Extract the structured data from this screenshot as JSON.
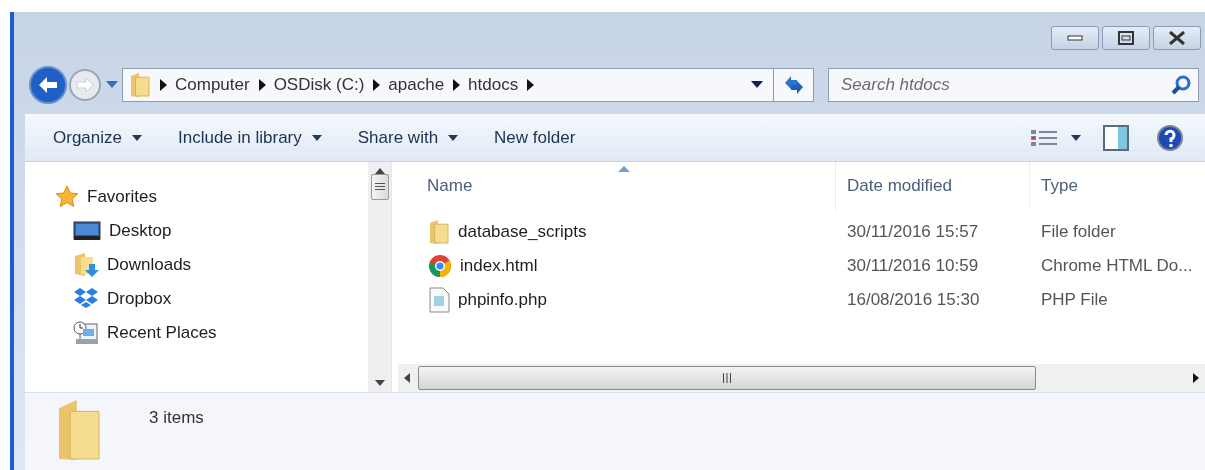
{
  "breadcrumb": [
    "Computer",
    "OSDisk (C:)",
    "apache",
    "htdocs"
  ],
  "search": {
    "placeholder": "Search htdocs"
  },
  "toolbar": [
    {
      "label": "Organize",
      "dropdown": true
    },
    {
      "label": "Include in library",
      "dropdown": true
    },
    {
      "label": "Share with",
      "dropdown": true
    },
    {
      "label": "New folder",
      "dropdown": false
    }
  ],
  "sidebar": {
    "items": [
      {
        "label": "Favorites",
        "kind": "star",
        "children": [
          {
            "label": "Desktop",
            "kind": "desktop"
          },
          {
            "label": "Downloads",
            "kind": "downloads"
          },
          {
            "label": "Dropbox",
            "kind": "dropbox"
          },
          {
            "label": "Recent Places",
            "kind": "recent"
          }
        ]
      }
    ]
  },
  "table": {
    "columns": [
      {
        "label": "Name",
        "sorted": true
      },
      {
        "label": "Date modified",
        "sorted": false
      },
      {
        "label": "Type",
        "sorted": false
      }
    ],
    "rows": [
      {
        "kind": "folder",
        "cells": [
          "database_scripts",
          "30/11/2016 15:57",
          "File folder"
        ]
      },
      {
        "kind": "chrome",
        "cells": [
          "index.html",
          "30/11/2016 10:59",
          "Chrome HTML Do..."
        ]
      },
      {
        "kind": "php",
        "cells": [
          "phpinfo.php",
          "16/08/2016 15:30",
          "PHP File"
        ]
      }
    ]
  },
  "status_bar": "3 items"
}
